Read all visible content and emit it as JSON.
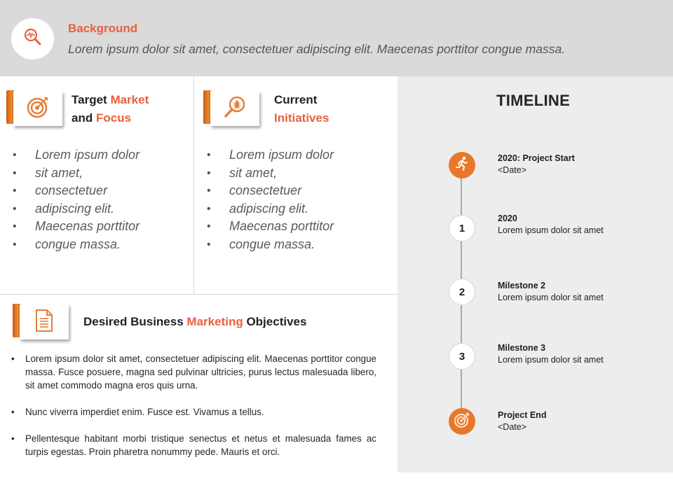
{
  "header": {
    "title": "Background",
    "text": "Lorem ipsum dolor sit amet, consectetuer adipiscing elit. Maecenas porttitor congue massa.",
    "icon": "magnifier-pulse-icon"
  },
  "colors": {
    "accent": "#e8603c",
    "orange": "#e9772b",
    "header_bg": "#dadada",
    "timeline_bg": "#ededed"
  },
  "target_market": {
    "title_parts": [
      "Target",
      "Market",
      "and",
      "Focus"
    ],
    "icon": "target-icon",
    "bullets": [
      "Lorem ipsum dolor",
      "sit amet,",
      "consectetuer",
      "adipiscing elit.",
      "Maecenas porttitor",
      "congue massa."
    ]
  },
  "current_initiatives": {
    "title_parts": [
      "Current",
      "Initiatives"
    ],
    "icon": "bug-search-icon",
    "bullets": [
      "Lorem ipsum dolor",
      "sit amet,",
      "consectetuer",
      "adipiscing elit.",
      "Maecenas porttitor",
      "congue massa."
    ]
  },
  "objectives": {
    "title_parts": [
      "Desired Business",
      "Marketing",
      "Objectives"
    ],
    "icon": "document-icon",
    "bullets": [
      "Lorem ipsum dolor sit amet, consectetuer adipiscing elit. Maecenas porttitor congue massa. Fusce posuere, magna sed pulvinar ultricies, purus lectus malesuada libero, sit amet commodo  magna eros quis urna.",
      "Nunc viverra imperdiet enim. Fusce est. Vivamus a tellus.",
      "Pellentesque habitant morbi tristique senectus et netus et malesuada fames ac turpis egestas. Proin pharetra nonummy pede. Mauris et orci."
    ]
  },
  "timeline": {
    "title": "TIMELINE",
    "items": [
      {
        "marker": "runner-icon",
        "title": "2020:  Project Start",
        "text": "<Date>"
      },
      {
        "marker": "1",
        "title": "2020",
        "text": "Lorem ipsum dolor sit amet"
      },
      {
        "marker": "2",
        "title": "Milestone 2",
        "text": "Lorem ipsum dolor sit amet"
      },
      {
        "marker": "3",
        "title": "Milestone 3",
        "text": "Lorem ipsum dolor sit amet"
      },
      {
        "marker": "target-icon",
        "title": "Project End",
        "text": "<Date>"
      }
    ]
  }
}
